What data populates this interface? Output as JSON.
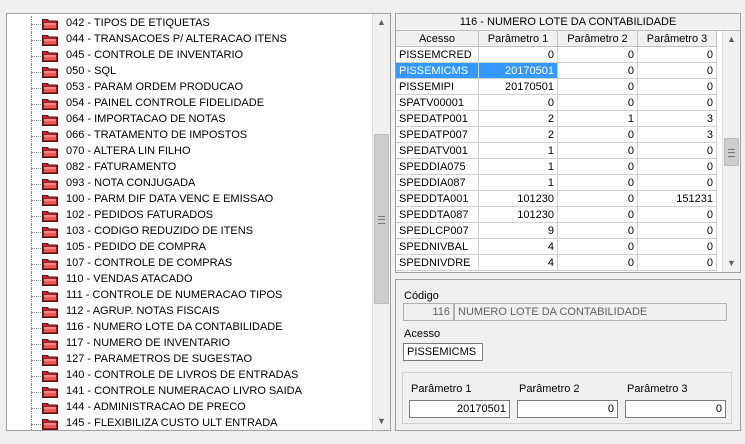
{
  "tree": {
    "items": [
      "042 - TIPOS DE ETIQUETAS",
      "044 - TRANSACOES P/ ALTERACAO ITENS",
      "045 - CONTROLE DE INVENTARIO",
      "050 - SQL",
      "053 - PARAM ORDEM PRODUCAO",
      "054 - PAINEL CONTROLE FIDELIDADE",
      "064 - IMPORTACAO DE NOTAS",
      "066 - TRATAMENTO DE IMPOSTOS",
      "070 - ALTERA LIN FILHO",
      "082 - FATURAMENTO",
      "093 - NOTA CONJUGADA",
      "100 - PARM DIF DATA VENC E EMISSAO",
      "102 - PEDIDOS FATURADOS",
      "103 - CODIGO REDUZIDO DE ITENS",
      "105 - PEDIDO DE COMPRA",
      "107 - CONTROLE DE COMPRAS",
      "110 - VENDAS ATACADO",
      "111 - CONTROLE DE NUMERACAO TIPOS",
      "112 - AGRUP. NOTAS FISCAIS",
      "116 - NUMERO LOTE DA CONTABILIDADE",
      "117 - NUMERO DE INVENTARIO",
      "127 - PARAMETROS DE SUGESTAO",
      "140 - CONTROLE DE LIVROS DE ENTRADAS",
      "141 - CONTROLE NUMERACAO LIVRO SAIDA",
      "144 - ADMINISTRACAO DE PRECO",
      "145 - FLEXIBILIZA CUSTO ULT ENTRADA"
    ]
  },
  "grid": {
    "title": "116 - NUMERO LOTE DA CONTABILIDADE",
    "columns": [
      "Acesso",
      "Parâmetro 1",
      "Parâmetro 2",
      "Parâmetro 3"
    ],
    "selected_row": 1,
    "rows": [
      [
        "PISSEMCRED",
        "0",
        "0",
        "0"
      ],
      [
        "PISSEMICMS",
        "20170501",
        "0",
        "0"
      ],
      [
        "PISSEMIPI",
        "20170501",
        "0",
        "0"
      ],
      [
        "SPATV00001",
        "0",
        "0",
        "0"
      ],
      [
        "SPEDATP001",
        "2",
        "1",
        "3"
      ],
      [
        "SPEDATP007",
        "2",
        "0",
        "3"
      ],
      [
        "SPEDATV001",
        "1",
        "0",
        "0"
      ],
      [
        "SPEDDIA075",
        "1",
        "0",
        "0"
      ],
      [
        "SPEDDIA087",
        "1",
        "0",
        "0"
      ],
      [
        "SPEDDTA001",
        "101230",
        "0",
        "151231"
      ],
      [
        "SPEDDTA087",
        "101230",
        "0",
        "0"
      ],
      [
        "SPEDLCP007",
        "9",
        "0",
        "0"
      ],
      [
        "SPEDNIVBAL",
        "4",
        "0",
        "0"
      ],
      [
        "SPEDNIVDRE",
        "4",
        "0",
        "0"
      ]
    ]
  },
  "detail": {
    "codigo_label": "Código",
    "codigo_value": "116",
    "descricao_value": "NUMERO LOTE DA CONTABILIDADE",
    "acesso_label": "Acesso",
    "acesso_value": "PISSEMICMS",
    "param1_label": "Parâmetro 1",
    "param1_value": "20170501",
    "param2_label": "Parâmetro 2",
    "param2_value": "0",
    "param3_label": "Parâmetro 3",
    "param3_value": "0"
  },
  "colors": {
    "selection": "#3399ff",
    "folder_fill": "#c8232c"
  }
}
